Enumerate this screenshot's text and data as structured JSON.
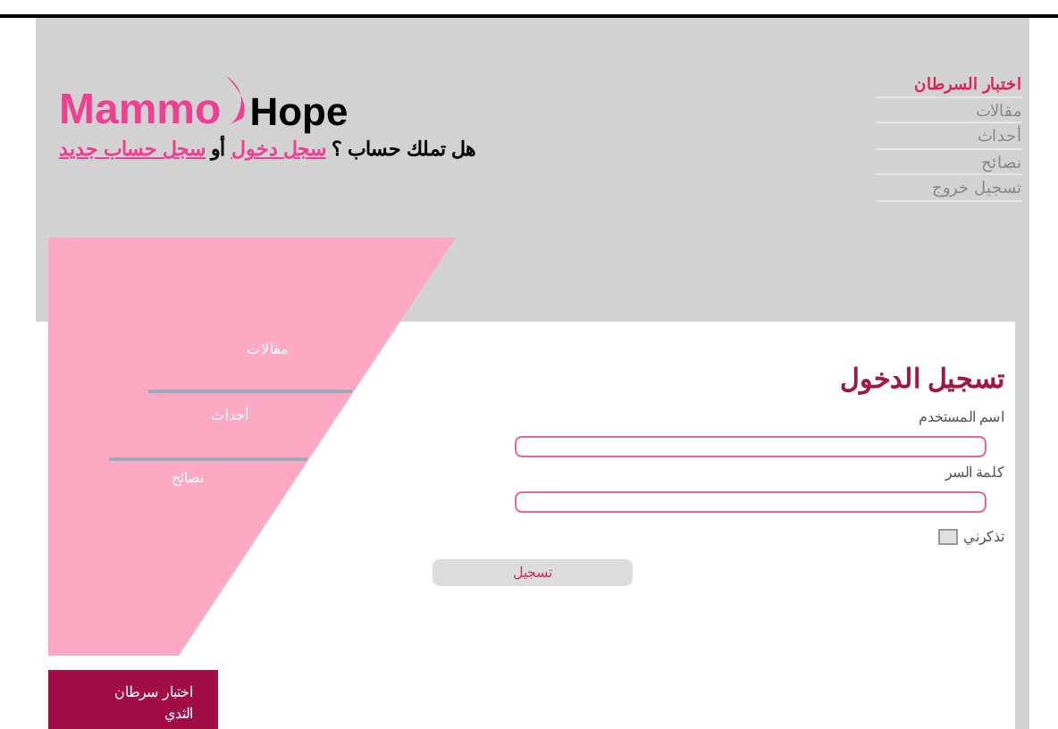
{
  "header": {
    "logo": {
      "part_1": "Mammo",
      "part_2": "Hope"
    },
    "account_prompt": {
      "question": "هل تملك حساب ؟",
      "login_link": "سجل دخول",
      "separator": "أو",
      "register_link": "سجل حساب جديد"
    }
  },
  "top_nav": [
    {
      "label": "اختبار السرطان",
      "selected": true
    },
    {
      "label": "مقالات",
      "selected": false
    },
    {
      "label": "أحداث",
      "selected": false
    },
    {
      "label": "نصائح",
      "selected": false
    },
    {
      "label": "تسجيل خروج",
      "selected": false
    }
  ],
  "side_menu": [
    {
      "label": "مقالات"
    },
    {
      "label": "أحداث"
    },
    {
      "label": "نصائح"
    }
  ],
  "side_box": {
    "label": "اختبار سرطان الثدي"
  },
  "login_form": {
    "title": "تسجيل الدخول",
    "fields": [
      {
        "label": "اسم المستخدم"
      },
      {
        "label": "كلمة السر"
      }
    ],
    "remember": {
      "label": "تذكرني",
      "checked": false
    },
    "submit": "تسجيل"
  }
}
